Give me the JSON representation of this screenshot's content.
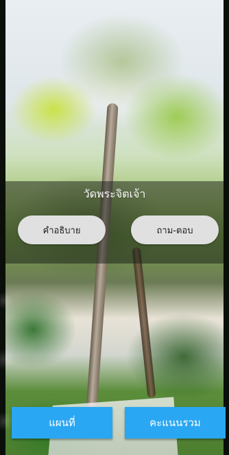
{
  "screen": {
    "title": "วัดพระจิตเจ้า"
  },
  "actions": {
    "description_label": "คำอธิบาย",
    "qa_label": "ถาม-ตอบ",
    "map_label": "แผนที่",
    "score_label": "คะแนนรวม"
  },
  "colors": {
    "primary_button": "#2aa7f3",
    "pill_button": "#e0e0e0",
    "overlay": "rgba(22,28,22,0.50)",
    "text_light": "#ffffff",
    "text_dark": "#1b1b1b"
  }
}
